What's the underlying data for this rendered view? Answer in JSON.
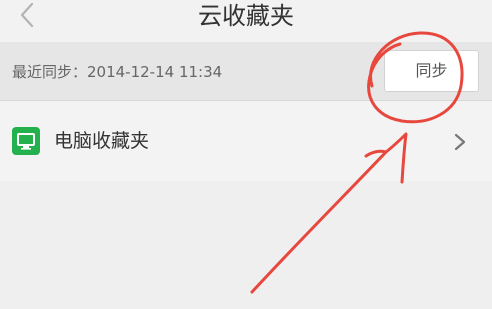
{
  "header": {
    "title": "云收藏夹",
    "back_icon": "chevron-left-icon"
  },
  "sync": {
    "last_sync_text": "最近同步：2014-12-14 11:34",
    "button_label": "同步"
  },
  "list": {
    "items": [
      {
        "label": "电脑收藏夹",
        "icon": "computer-icon",
        "icon_color": "#22b14c",
        "trailing_icon": "chevron-right-icon"
      }
    ]
  },
  "annotation": {
    "color": "#e8473e",
    "shapes": [
      "circle-mark",
      "arrow-mark"
    ]
  }
}
